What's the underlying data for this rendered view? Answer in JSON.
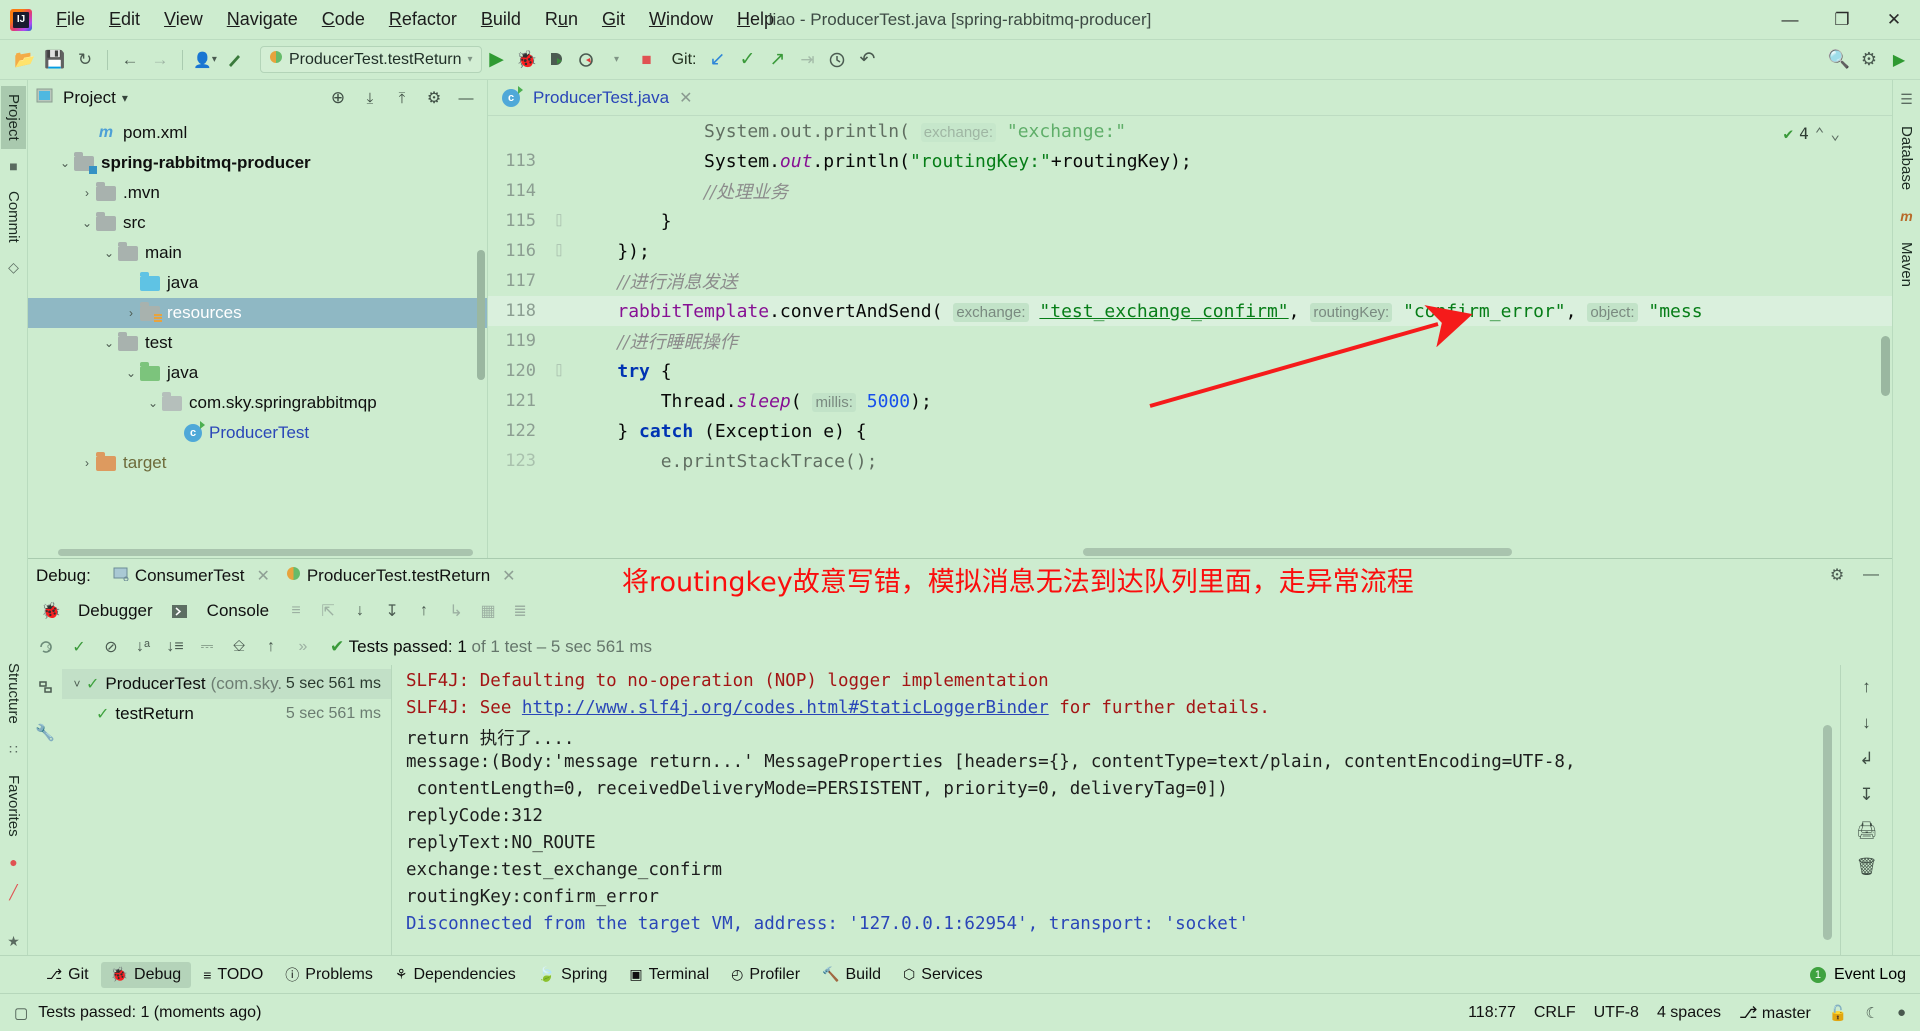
{
  "window": {
    "title": "liao - ProducerTest.java [spring-rabbitmq-producer]",
    "minimize": "—",
    "maximize": "❐",
    "close": "✕"
  },
  "menubar": [
    {
      "label": "File",
      "mnemonic": "F"
    },
    {
      "label": "Edit",
      "mnemonic": "E"
    },
    {
      "label": "View",
      "mnemonic": "V"
    },
    {
      "label": "Navigate",
      "mnemonic": "N"
    },
    {
      "label": "Code",
      "mnemonic": "C"
    },
    {
      "label": "Refactor",
      "mnemonic": "R"
    },
    {
      "label": "Build",
      "mnemonic": "B"
    },
    {
      "label": "Run",
      "mnemonic": "u"
    },
    {
      "label": "Git",
      "mnemonic": "G"
    },
    {
      "label": "Window",
      "mnemonic": "W"
    },
    {
      "label": "Help",
      "mnemonic": "H"
    }
  ],
  "toolbar": {
    "open_icon": "📂",
    "save_icon": "💾",
    "sync_icon": "↻",
    "back_icon": "←",
    "forward_icon": "→",
    "profile_icon": "👤",
    "build_icon": "🔨",
    "run_config": "ProducerTest.testReturn",
    "run_icon": "▶",
    "debug_icon": "🐞",
    "coverage_icon": "◑",
    "profiler_icon": "◴",
    "stop_icon": "■",
    "git_label": "Git:",
    "git_update_icon": "↙",
    "git_commit_icon": "✓",
    "git_push_icon": "↗",
    "git_rebase_icon": "⇥",
    "git_history_icon": "🕓",
    "git_rollback_icon": "↶",
    "search_icon": "🔍",
    "settings_icon": "⚙",
    "run_anything_icon": "▶"
  },
  "left_strip": {
    "tabs": [
      "Project",
      "Commit"
    ],
    "structure": "Structure",
    "favorites": "Favorites",
    "icons": [
      "■",
      "◇",
      "●",
      "⊘",
      "★"
    ]
  },
  "right_strip": {
    "tabs": [
      "Database",
      "Maven"
    ],
    "icon_top": "≡",
    "icon_m": "m"
  },
  "project_panel": {
    "title": "Project",
    "dropdown": "▾",
    "locate_icon": "⊕",
    "expand_icon": "⤓",
    "collapse_icon": "⤒",
    "settings_icon": "⚙",
    "hide_icon": "—",
    "tree": [
      {
        "label": "pom.xml",
        "indent": 2,
        "arrow": "",
        "icon": "maven",
        "style": ""
      },
      {
        "label": "spring-rabbitmq-producer",
        "indent": 1,
        "arrow": "v",
        "icon": "module",
        "style": "bold"
      },
      {
        "label": ".mvn",
        "indent": 2,
        "arrow": ">",
        "icon": "gray",
        "style": ""
      },
      {
        "label": "src",
        "indent": 2,
        "arrow": "v",
        "icon": "gray",
        "style": ""
      },
      {
        "label": "main",
        "indent": 3,
        "arrow": "v",
        "icon": "gray",
        "style": ""
      },
      {
        "label": "java",
        "indent": 4,
        "arrow": "",
        "icon": "blue",
        "style": ""
      },
      {
        "label": "resources",
        "indent": 4,
        "arrow": ">",
        "icon": "res",
        "style": "sel"
      },
      {
        "label": "test",
        "indent": 3,
        "arrow": "v",
        "icon": "gray",
        "style": ""
      },
      {
        "label": "java",
        "indent": 4,
        "arrow": "v",
        "icon": "green",
        "style": ""
      },
      {
        "label": "com.sky.springrabbitmqp",
        "indent": 5,
        "arrow": "v",
        "icon": "pkg",
        "style": ""
      },
      {
        "label": "ProducerTest",
        "indent": 6,
        "arrow": "",
        "icon": "class",
        "style": "link"
      },
      {
        "label": "target",
        "indent": 2,
        "arrow": ">",
        "icon": "orange",
        "style": "target"
      }
    ]
  },
  "editor": {
    "tab": {
      "label": "ProducerTest.java",
      "close": "✕"
    },
    "inspection": {
      "icon": "✔",
      "count": "4",
      "up": "⌃",
      "down": "⌄"
    },
    "lines": [
      {
        "num": "",
        "fold": "",
        "clipped": true,
        "tokens": [
          {
            "t": "            ",
            "c": "k-pln"
          },
          {
            "t": "System.out.println( ",
            "c": "k-pln"
          },
          {
            "t": "exchange:",
            "c": "k-hint"
          },
          {
            "t": " \"exchange:\"",
            "c": "k-str"
          }
        ]
      },
      {
        "num": "113",
        "fold": "",
        "tokens": [
          {
            "t": "            ",
            "c": "k-pln"
          },
          {
            "t": "System.",
            "c": "k-pln"
          },
          {
            "t": "out",
            "c": "k-fld"
          },
          {
            "t": ".println(",
            "c": "k-pln"
          },
          {
            "t": "\"routingKey:\"",
            "c": "k-str"
          },
          {
            "t": "+routingKey);",
            "c": "k-pln"
          }
        ]
      },
      {
        "num": "114",
        "fold": "",
        "tokens": [
          {
            "t": "            ",
            "c": "k-pln"
          },
          {
            "t": "//处理业务",
            "c": "k-cmt"
          }
        ]
      },
      {
        "num": "115",
        "fold": "⌷",
        "tokens": [
          {
            "t": "        }",
            "c": "k-pln"
          }
        ]
      },
      {
        "num": "116",
        "fold": "⌷",
        "tokens": [
          {
            "t": "    });",
            "c": "k-pln"
          }
        ]
      },
      {
        "num": "117",
        "fold": "",
        "tokens": [
          {
            "t": "    ",
            "c": "k-pln"
          },
          {
            "t": "//进行消息发送",
            "c": "k-cmt"
          }
        ]
      },
      {
        "num": "118",
        "fold": "",
        "hl": true,
        "tokens": [
          {
            "t": "    ",
            "c": "k-pln"
          },
          {
            "t": "rabbitTemplate",
            "c": "k-var"
          },
          {
            "t": ".convertAndSend( ",
            "c": "k-pln"
          },
          {
            "t": "exchange:",
            "c": "k-hint"
          },
          {
            "t": " ",
            "c": "k-pln"
          },
          {
            "t": "\"test_exchange_confirm\"",
            "c": "k-str-u"
          },
          {
            "t": ", ",
            "c": "k-pln"
          },
          {
            "t": "routingKey:",
            "c": "k-hint"
          },
          {
            "t": " ",
            "c": "k-pln"
          },
          {
            "t": "\"confirm_error\"",
            "c": "k-str"
          },
          {
            "t": ", ",
            "c": "k-pln"
          },
          {
            "t": "object:",
            "c": "k-hint"
          },
          {
            "t": " ",
            "c": "k-pln"
          },
          {
            "t": "\"mess",
            "c": "k-str"
          }
        ]
      },
      {
        "num": "119",
        "fold": "",
        "tokens": [
          {
            "t": "    ",
            "c": "k-pln"
          },
          {
            "t": "//进行睡眠操作",
            "c": "k-cmt"
          }
        ]
      },
      {
        "num": "120",
        "fold": "⌷",
        "tokens": [
          {
            "t": "    ",
            "c": "k-pln"
          },
          {
            "t": "try",
            "c": "k-kw"
          },
          {
            "t": " {",
            "c": "k-pln"
          }
        ]
      },
      {
        "num": "121",
        "fold": "",
        "tokens": [
          {
            "t": "        ",
            "c": "k-pln"
          },
          {
            "t": "Thread.",
            "c": "k-pln"
          },
          {
            "t": "sleep",
            "c": "k-fld"
          },
          {
            "t": "( ",
            "c": "k-pln"
          },
          {
            "t": "millis:",
            "c": "k-hint"
          },
          {
            "t": " ",
            "c": "k-pln"
          },
          {
            "t": "5000",
            "c": "k-num"
          },
          {
            "t": ");",
            "c": "k-pln"
          }
        ]
      },
      {
        "num": "122",
        "fold": "",
        "tokens": [
          {
            "t": "    } ",
            "c": "k-pln"
          },
          {
            "t": "catch",
            "c": "k-kw"
          },
          {
            "t": " (Exception e) {",
            "c": "k-pln"
          }
        ]
      },
      {
        "num": "123",
        "fold": "",
        "clipped": true,
        "tokens": [
          {
            "t": "        e.printStackTrace();",
            "c": "k-pln"
          }
        ]
      }
    ]
  },
  "debug": {
    "label": "Debug:",
    "tabs": [
      {
        "label": "ConsumerTest",
        "icon": "console",
        "close": "✕"
      },
      {
        "label": "ProducerTest.testReturn",
        "icon": "test",
        "close": "✕"
      }
    ],
    "annotation": "将routingkey故意写错，模拟消息无法到达队列里面，走异常流程",
    "annotation_color": "#fb0d0d",
    "settings_icon": "⚙",
    "hide_icon": "—",
    "subtabs": [
      {
        "label": "Debugger",
        "icon": "🐞"
      },
      {
        "label": "Console",
        "icon": "▶"
      }
    ],
    "sub_icons": [
      "≡",
      "⤴",
      "↓",
      "↧",
      "↑",
      "↴",
      "▦",
      "≣"
    ],
    "run_icons": [
      "↺9",
      "✓",
      "⊘",
      "↓a₃",
      "↓≡",
      "⤓",
      "⤒",
      "↑",
      "»"
    ],
    "test_status": {
      "icon": "✔",
      "main": "Tests passed: 1",
      "detail": "of 1 test – 5 sec 561 ms"
    },
    "test_tree": [
      {
        "name": "ProducerTest",
        "pkg": "(com.sky.",
        "time": "5 sec 561 ms",
        "indent": 0,
        "arrow": "v",
        "selected": true
      },
      {
        "name": "testReturn",
        "pkg": "",
        "time": "5 sec 561 ms",
        "indent": 1,
        "arrow": "",
        "selected": false
      }
    ],
    "left_icons": [
      "↻",
      "🔧"
    ],
    "console": [
      {
        "text": "SLF4J: Defaulting to no-operation (NOP) logger implementation",
        "style": "err"
      },
      {
        "text": "SLF4J: See ",
        "style": "err",
        "link": "http://www.slf4j.org/codes.html#StaticLoggerBinder",
        "after": " for further details."
      },
      {
        "text": "return 执行了....",
        "style": ""
      },
      {
        "text": "message:(Body:'message return...' MessageProperties [headers={}, contentType=text/plain, contentEncoding=UTF-8,",
        "style": ""
      },
      {
        "text": " contentLength=0, receivedDeliveryMode=PERSISTENT, priority=0, deliveryTag=0])",
        "style": ""
      },
      {
        "text": "replyCode:312",
        "style": ""
      },
      {
        "text": "replyText:NO_ROUTE",
        "style": ""
      },
      {
        "text": "exchange:test_exchange_confirm",
        "style": ""
      },
      {
        "text": "routingKey:confirm_error",
        "style": ""
      },
      {
        "text": "Disconnected from the target VM, address: '127.0.0.1:62954', transport: 'socket'",
        "style": "blue"
      }
    ],
    "side_icons": [
      "↑",
      "↓",
      "↰",
      "↧",
      "🖨",
      "🗑"
    ]
  },
  "toolwindows": [
    {
      "label": "Git",
      "icon": "⎇",
      "active": false
    },
    {
      "label": "Debug",
      "icon": "🐞",
      "active": true
    },
    {
      "label": "TODO",
      "icon": "≡",
      "active": false
    },
    {
      "label": "Problems",
      "icon": "ⓘ",
      "active": false
    },
    {
      "label": "Dependencies",
      "icon": "⚘",
      "active": false
    },
    {
      "label": "Spring",
      "icon": "🍃",
      "active": false
    },
    {
      "label": "Terminal",
      "icon": "▣",
      "active": false
    },
    {
      "label": "Profiler",
      "icon": "◴",
      "active": false
    },
    {
      "label": "Build",
      "icon": "🔨",
      "active": false
    },
    {
      "label": "Services",
      "icon": "⬡",
      "active": false
    }
  ],
  "event_log": {
    "label": "Event Log",
    "badge": "1"
  },
  "statusbar": {
    "message": "Tests passed: 1 (moments ago)",
    "caret": "118:77",
    "line_sep": "CRLF",
    "encoding": "UTF-8",
    "indent": "4 spaces",
    "branch": "master",
    "branch_icon": "⎇",
    "lock_icon": "🔓",
    "inspect_icon": "☾",
    "notif_icon": "●"
  }
}
